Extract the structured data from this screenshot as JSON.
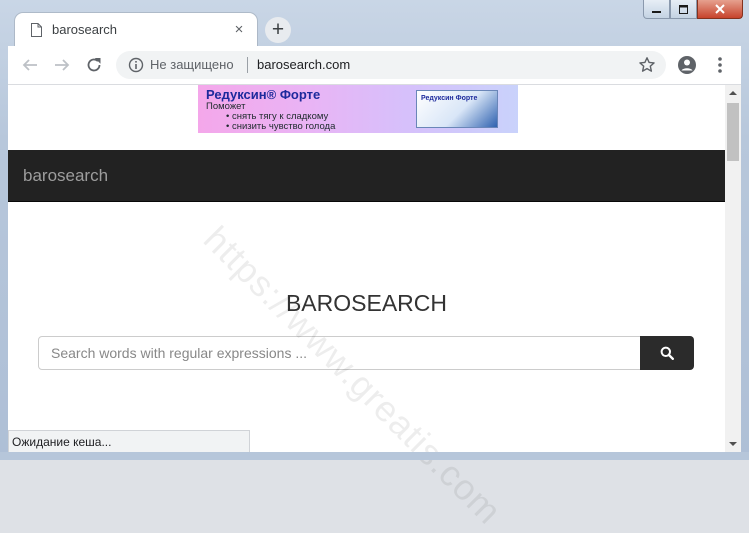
{
  "tab": {
    "title": "barosearch",
    "close_glyph": "×",
    "doc_icon": "document-icon"
  },
  "new_tab": {
    "glyph": "+"
  },
  "window_controls": {
    "minimize": "minimize-icon",
    "maximize": "maximize-icon",
    "close": "close-icon"
  },
  "toolbar": {
    "back": "back-arrow-icon",
    "forward": "forward-arrow-icon",
    "reload": "reload-icon",
    "insecure_label": "Не защищено",
    "url": "barosearch.com",
    "bookmark": "star-icon",
    "profile": "account-icon",
    "menu": "more-vert-icon"
  },
  "banner": {
    "title": "Редуксин® Форте",
    "subtitle": "Поможет",
    "bullets": [
      "• снять тягу к сладкому",
      "• снизить чувство голода"
    ],
    "box_label": "Редуксин Форте"
  },
  "navbar": {
    "brand": "barosearch"
  },
  "main": {
    "heading": "BAROSEARCH",
    "search_placeholder": "Search words with regular expressions ...",
    "search_button_icon": "search-icon"
  },
  "status": {
    "text": "Ожидание кеша..."
  },
  "watermark": {
    "text": "https://www.greatis.com"
  },
  "colors": {
    "navbar_bg": "#222222",
    "brand_text": "#9d9d9d",
    "search_button_bg": "#2b2b2b",
    "heading_text": "#333333"
  }
}
